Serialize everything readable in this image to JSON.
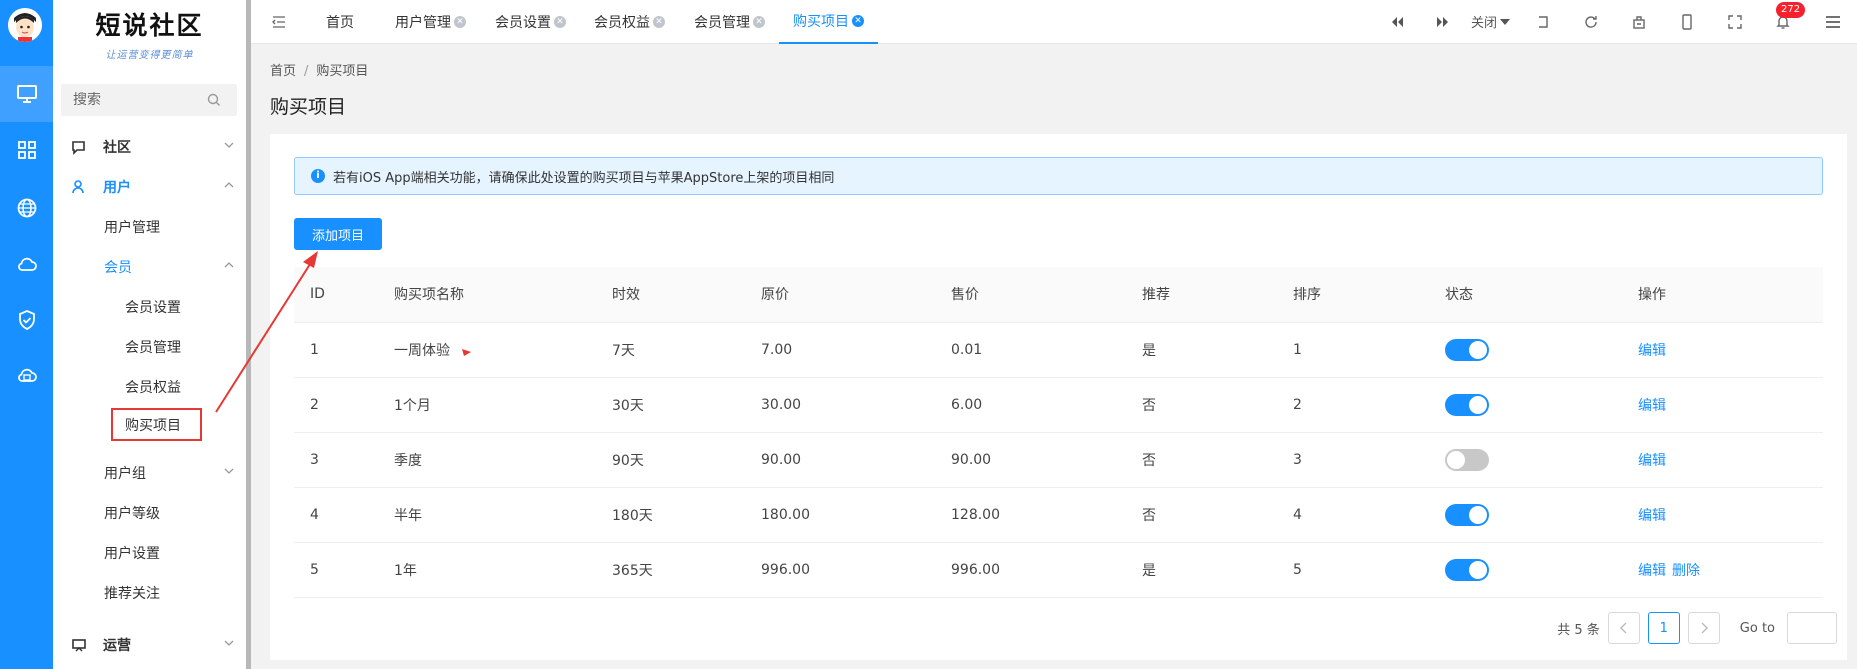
{
  "brand": {
    "name": "短说社区",
    "slogan": "让运营变得更简单"
  },
  "search": {
    "placeholder": "搜索"
  },
  "menu": {
    "community": "社区",
    "user": "用户",
    "user_manage": "用户管理",
    "member": "会员",
    "member_settings": "会员设置",
    "member_manage": "会员管理",
    "member_rights": "会员权益",
    "purchase_items": "购买项目",
    "user_group": "用户组",
    "user_level": "用户等级",
    "user_settings": "用户设置",
    "recommend_follow": "推荐关注",
    "operation": "运营"
  },
  "tabs": [
    {
      "label": "首页"
    },
    {
      "label": "用户管理"
    },
    {
      "label": "会员设置"
    },
    {
      "label": "会员权益"
    },
    {
      "label": "会员管理"
    },
    {
      "label": "购买项目"
    }
  ],
  "toolbar": {
    "close_label": "关闭",
    "notifications": "272"
  },
  "breadcrumb": {
    "home": "首页",
    "separator": "/",
    "current": "购买项目"
  },
  "page": {
    "title": "购买项目"
  },
  "alert": {
    "text": "若有iOS App端相关功能，请确保此处设置的购买项目与苹果AppStore上架的项目相同"
  },
  "add_button": "添加项目",
  "table": {
    "headers": [
      "ID",
      "购买项名称",
      "时效",
      "原价",
      "售价",
      "推荐",
      "排序",
      "状态",
      "操作"
    ],
    "rows": [
      {
        "id": "1",
        "name": "一周体验",
        "duration": "7天",
        "original": "7.00",
        "price": "0.01",
        "recommend": "是",
        "sort": "1",
        "enabled": true,
        "edit": "编辑",
        "delete": ""
      },
      {
        "id": "2",
        "name": "1个月",
        "duration": "30天",
        "original": "30.00",
        "price": "6.00",
        "recommend": "否",
        "sort": "2",
        "enabled": true,
        "edit": "编辑",
        "delete": ""
      },
      {
        "id": "3",
        "name": "季度",
        "duration": "90天",
        "original": "90.00",
        "price": "90.00",
        "recommend": "否",
        "sort": "3",
        "enabled": false,
        "edit": "编辑",
        "delete": ""
      },
      {
        "id": "4",
        "name": "半年",
        "duration": "180天",
        "original": "180.00",
        "price": "128.00",
        "recommend": "否",
        "sort": "4",
        "enabled": true,
        "edit": "编辑",
        "delete": ""
      },
      {
        "id": "5",
        "name": "1年",
        "duration": "365天",
        "original": "996.00",
        "price": "996.00",
        "recommend": "是",
        "sort": "5",
        "enabled": true,
        "edit": "编辑",
        "delete": "删除"
      }
    ]
  },
  "pagination": {
    "total": "共 5 条",
    "current": "1",
    "goto": "Go to"
  },
  "colors": {
    "primary": "#1890ff",
    "annotation": "#e53935"
  }
}
